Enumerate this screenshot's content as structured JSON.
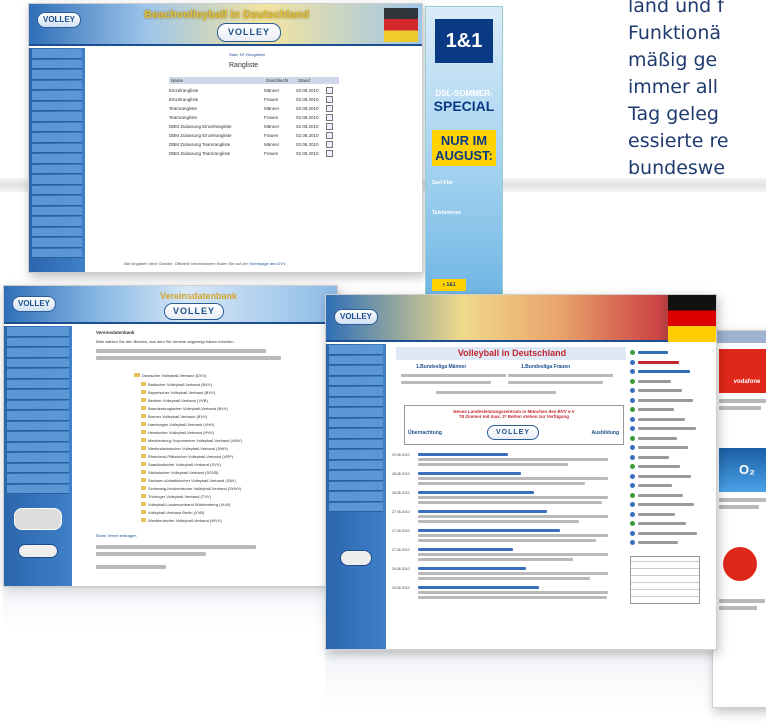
{
  "overlay_text": {
    "lines": [
      "land und f",
      "Funktionä",
      "mäßig ge",
      "immer all",
      "Tag geleg",
      "essierte re",
      "bundeswe"
    ]
  },
  "shot1": {
    "header_title": "Beachvolleyball in Deutschland",
    "logo": "VOLLEY",
    "breadcrumb": "Start: DF-Ranglisten",
    "heading": "Rangliste",
    "columns": [
      "Name",
      "Geschlecht",
      "Stand"
    ],
    "rows": [
      {
        "name": "Einzelrangliste",
        "gender": "Männer",
        "date": "02.08.2010"
      },
      {
        "name": "Einzelrangliste",
        "gender": "Frauen",
        "date": "02.08.2010"
      },
      {
        "name": "Teamrangliste",
        "gender": "Männer",
        "date": "02.08.2010"
      },
      {
        "name": "Teamrangliste",
        "gender": "Frauen",
        "date": "02.08.2010"
      },
      {
        "name": "DBM Zulassung Einzelrangliste",
        "gender": "Männer",
        "date": "02.08.2010"
      },
      {
        "name": "DBM Zulassung Einzelrangliste",
        "gender": "Frauen",
        "date": "02.08.2010"
      },
      {
        "name": "DBM Zulassung Teamrangliste",
        "gender": "Männer",
        "date": "02.08.2010"
      },
      {
        "name": "DBM Zulassung Teamrangliste",
        "gender": "Frauen",
        "date": "02.08.2010"
      }
    ],
    "footer_note": "Alle Angaben ohne Gewähr. Offizielle Informationen finden Sie auf der",
    "footer_link": "Homepage des DVV"
  },
  "ad1": {
    "brand": "1&1",
    "headline1": "DSL-SOMMER-",
    "headline2": "SPECIAL",
    "headline3": "NUR IM",
    "headline4": "AUGUST:",
    "bullet1": "Surf-Flat",
    "bullet2": "Telefonieren",
    "cta": "» 1&1"
  },
  "shot2": {
    "header_title": "Vereinsdatenbank",
    "logo": "VOLLEY",
    "heading": "Vereinsdatenbank",
    "intro": "Bitte wählen Sie den Bereich, aus dem Sie Vereine angezeigt haben möchten.",
    "root": "Deutscher Volleyball-Verband (DVV)",
    "tree_items": [
      "Badischer Volleyball-Verband (BVV)",
      "Bayerischer Volleyball-Verband (BVV)",
      "Berliner Volleyball-Verband (VVB)",
      "Brandenburgischer Volleyball-Verband (BVV)",
      "Bremer Volleyball-Verband (BVV)",
      "Hamburger Volleyball-Verband (VHH)",
      "Hessischer Volleyball-Verband (HVV)",
      "Mecklenburg-Vorpommern Volleyball-Verband (VMV)",
      "Niedersächsischer Volleyball-Verband (NWV)",
      "Rheinland-Pfälzischer Volleyball-Verband (VRP)",
      "Saarländischer Volleyball-Verband (SVV)",
      "Sächsischer Volleyball-Verband (SSVB)",
      "Sachsen-Anhaltinischer Volleyball-Verband (SAV)",
      "Schleswig-Holsteinischer Volleyball-Verband (SHVV)",
      "Thüringer Volleyball-Verband (TVV)",
      "Volleyball-Landesverband Württemberg (VLW)",
      "Volleyball-Verband Berlin (VVB)",
      "Westdeutscher Volleyball-Verband (WVV)"
    ],
    "link": "Einen Verein eintragen"
  },
  "shot3": {
    "header_title": "Volleyball in Deutschland",
    "logo": "VOLLEY",
    "col1_title": "1.Bundesliga Männer",
    "col2_title": "1.Bundesliga Frauen",
    "promo1": "Neues Landesleistungszentrum in München des BVV e.V",
    "promo2": "78 Zimmer mit max. 2* Betten stehen zur Verfügung",
    "left_promo": "Übernachtung",
    "right_promo": "Ausbildung",
    "news_dates": [
      "29.08.2010",
      "28.08.2010",
      "28.08.2010",
      "27.08.2010",
      "27.08.2010",
      "27.08.2010",
      "26.08.2010",
      "26.08.2010"
    ]
  },
  "shot4": {
    "brand_o2": "O₂",
    "brand_vodafone": "vodafone"
  }
}
